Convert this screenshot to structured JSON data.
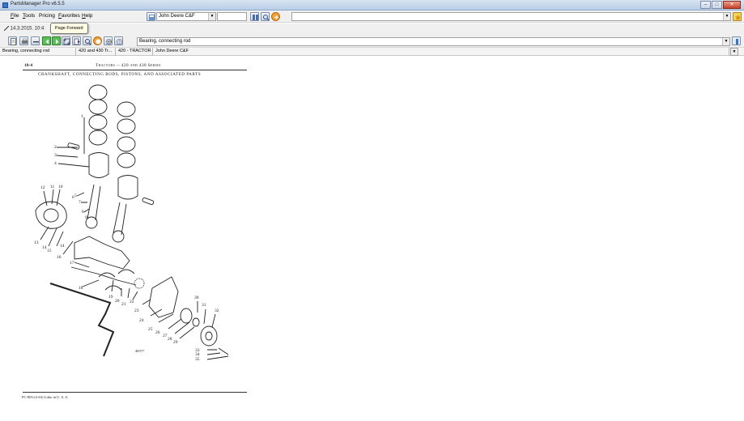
{
  "window": {
    "title": "PartsManager Pro v6.5.5",
    "buttons": {
      "minimize": "–",
      "maximize": "□",
      "close": "✕"
    }
  },
  "menu": {
    "items": [
      {
        "ul": "F",
        "rest": "ile"
      },
      {
        "ul": "T",
        "rest": "ools"
      },
      {
        "ul": "",
        "rest": "Pricing"
      },
      {
        "ul": "F",
        "rest": "avorites",
        "prefix": ""
      },
      {
        "ul": "H",
        "rest": "elp"
      }
    ]
  },
  "catalog_combo": {
    "value": "John Deere C&F"
  },
  "date_label": "14.3.2015. 10:4",
  "tooltip": "Page Forward",
  "part_combo": {
    "value": "Bearing, connecting rod"
  },
  "breadcrumb": [
    "Bearing, connecting rod",
    "420 and 430 Tr...",
    "420 - TRACTOR",
    "John Deere C&F"
  ],
  "document": {
    "page_number": "10-4",
    "series_title": "Tractors -- 420 and 430 Series",
    "section_title": "CRANKSHAFT, CONNECTING RODS, PISTONS, AND ASSOCIATED PARTS",
    "figure_id": "48377",
    "footer": "PC-805-(2-63) Litho in U. S. A.",
    "callouts": [
      "1",
      "2",
      "3",
      "4",
      "5",
      "6",
      "7",
      "8",
      "9",
      "10",
      "11",
      "12",
      "13",
      "14",
      "14",
      "15",
      "16",
      "17",
      "18",
      "19",
      "20",
      "21",
      "22",
      "23",
      "24",
      "25",
      "26",
      "27",
      "28",
      "29",
      "30",
      "31",
      "32",
      "33",
      "34",
      "35",
      "36"
    ]
  },
  "colors": {
    "accent": "#3a74c4",
    "toolbar_green": "#3aa13a",
    "toolbar_orange": "#e8861c"
  }
}
